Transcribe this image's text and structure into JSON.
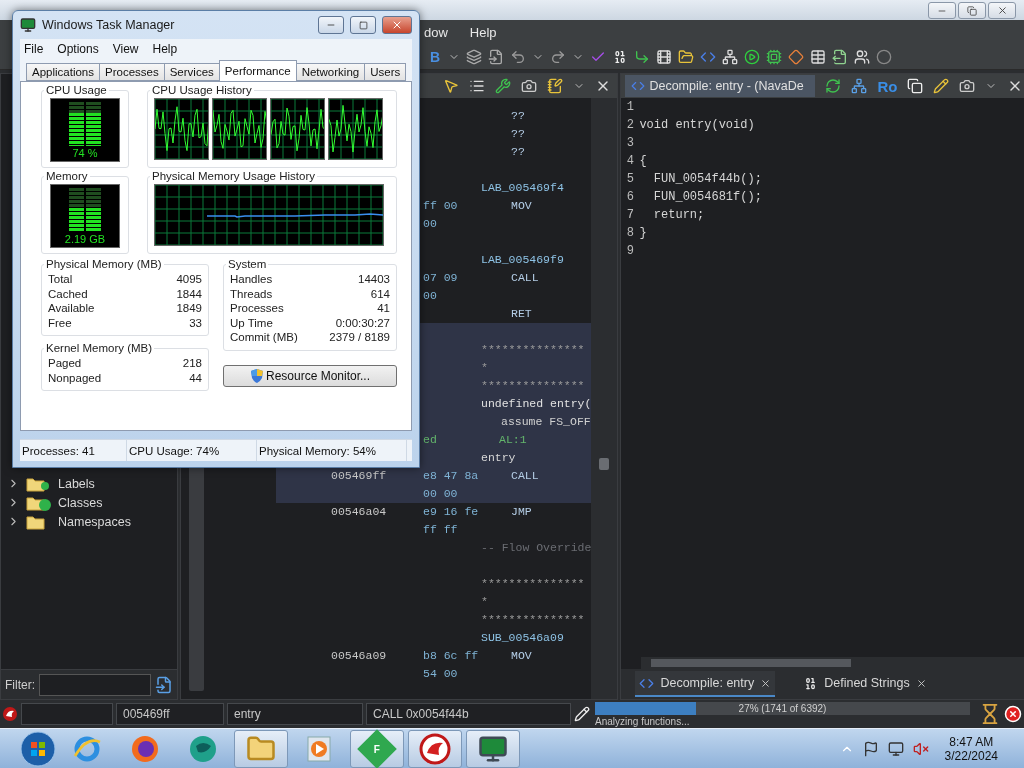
{
  "menu": [
    {
      "label": "dow"
    },
    {
      "label": "Help"
    }
  ],
  "toolbar": {
    "label": "B"
  },
  "tree": [
    {
      "label": "Labels",
      "kind": "labels",
      "expanded": false
    },
    {
      "label": "Classes",
      "kind": "classes",
      "expanded": false
    },
    {
      "label": "Namespaces",
      "kind": "namespaces",
      "expanded": false
    }
  ],
  "filter": {
    "label": "Filter:"
  },
  "listing": {
    "rows": [
      {
        "text": "??",
        "kind": "instruction",
        "selected": false
      },
      {
        "text": "??",
        "kind": "instruction",
        "selected": false
      },
      {
        "text": "??",
        "kind": "instruction",
        "selected": false
      },
      {
        "kind": "blank",
        "selected": false
      },
      {
        "text": "LAB_005469f4",
        "kind": "label",
        "selected": false
      },
      {
        "bytes": "ff 00",
        "text": "MOV",
        "kind": "instruction",
        "selected": false
      },
      {
        "bytes": "00",
        "kind": "continuation",
        "selected": false
      },
      {
        "kind": "blank",
        "selected": false
      },
      {
        "text": "LAB_005469f9",
        "kind": "label",
        "selected": false
      },
      {
        "bytes": "07 09",
        "text": "CALL",
        "kind": "instruction",
        "selected": false
      },
      {
        "bytes": "00",
        "kind": "continuation",
        "selected": false
      },
      {
        "text": "RET",
        "kind": "instruction",
        "selected": false
      },
      {
        "kind": "blank",
        "selected": true
      },
      {
        "text": "***************\n*\n***************",
        "kind": "comment",
        "selected": true
      },
      {
        "text": "undefined entry(",
        "kind": "signature",
        "selected": true
      },
      {
        "text": "assume FS_OFF",
        "kind": "detail",
        "selected": true
      },
      {
        "bytes": "ed",
        "text": "AL:1",
        "kind": "register",
        "selected": true
      },
      {
        "text": "entry",
        "kind": "symbol",
        "selected": true
      },
      {
        "address": "005469ff",
        "bytes": "e8 47 8a",
        "text": "CALL",
        "kind": "instruction",
        "selected": true
      },
      {
        "bytes": "00 00",
        "kind": "continuation",
        "selected": true
      },
      {
        "address": "00546a04",
        "bytes": "e9 16 fe",
        "text": "JMP",
        "kind": "instruction",
        "selected": false
      },
      {
        "bytes": "ff ff",
        "kind": "continuation",
        "selected": false
      },
      {
        "text": "-- Flow Override",
        "kind": "flow",
        "selected": false
      },
      {
        "kind": "blank",
        "selected": false
      },
      {
        "text": "***************\n*\n***************",
        "kind": "comment",
        "selected": false
      },
      {
        "text": "SUB_00546a09",
        "kind": "label",
        "selected": false
      },
      {
        "address": "00546a09",
        "bytes": "b8 6c ff",
        "text": "MOV",
        "kind": "instruction",
        "selected": false
      },
      {
        "bytes": "54 00",
        "kind": "continuation",
        "selected": false
      }
    ]
  },
  "decompiler": {
    "title": "Decompile: entry - (NavaDe",
    "button_label": "Ro",
    "lines": [
      {
        "number": "1"
      },
      {
        "number": "2",
        "code": "void entry(void)"
      },
      {
        "number": "3"
      },
      {
        "number": "4",
        "code": "{"
      },
      {
        "number": "5",
        "code": "  FUN_0054f44b();"
      },
      {
        "number": "6",
        "code": "  FUN_0054681f();"
      },
      {
        "number": "7",
        "code": "  return;"
      },
      {
        "number": "8",
        "code": "}"
      },
      {
        "number": "9"
      }
    ]
  },
  "bottom_tabs": [
    {
      "label": "Decompile: entry",
      "kind": "decompile",
      "selected": true
    },
    {
      "label": "Defined Strings",
      "kind": "strings",
      "selected": false
    }
  ],
  "status_bar": {
    "fields": [
      "005469ff",
      "entry",
      "CALL 0x0054f44b"
    ]
  },
  "progress": {
    "level": 0.27,
    "reading": "27% (1741 of 6392)",
    "message": "Analyzing functions..."
  },
  "task_manager": {
    "title": "Windows Task Manager",
    "menu": [
      "File",
      "Options",
      "View",
      "Help"
    ],
    "tabs": [
      {
        "label": "Applications",
        "selected": false
      },
      {
        "label": "Processes",
        "selected": false
      },
      {
        "label": "Services",
        "selected": false
      },
      {
        "label": "Performance",
        "selected": true
      },
      {
        "label": "Networking",
        "selected": false
      },
      {
        "label": "Users",
        "selected": false
      }
    ],
    "cpu": {
      "title": "CPU Usage",
      "reading": "74 %",
      "level": 0.74
    },
    "cpu_history": {
      "title": "CPU Usage History"
    },
    "memory": {
      "title": "Memory",
      "reading": "2.19 GB",
      "level": 0.54
    },
    "memory_history": {
      "title": "Physical Memory Usage History"
    },
    "physical_memory": {
      "title": "Physical Memory (MB)",
      "rows": [
        {
          "label": "Total",
          "value": "4095"
        },
        {
          "label": "Cached",
          "value": "1844"
        },
        {
          "label": "Available",
          "value": "1849"
        },
        {
          "label": "Free",
          "value": "33"
        }
      ]
    },
    "kernel_memory": {
      "title": "Kernel Memory (MB)",
      "rows": [
        {
          "label": "Paged",
          "value": "218"
        },
        {
          "label": "Nonpaged",
          "value": "44"
        }
      ]
    },
    "system": {
      "title": "System",
      "rows": [
        {
          "label": "Handles",
          "value": "14403"
        },
        {
          "label": "Threads",
          "value": "614"
        },
        {
          "label": "Processes",
          "value": "41"
        },
        {
          "label": "Up Time",
          "value": "0:00:30:27"
        },
        {
          "label": "Commit (MB)",
          "value": "2379 / 8189"
        }
      ]
    },
    "resource_button": "Resource Monitor...",
    "status": [
      "Processes: 41",
      "CPU Usage: 74%",
      "Physical Memory: 54%"
    ]
  },
  "taskbar": {
    "items": [
      {
        "kind": "browser-e",
        "running": false
      },
      {
        "kind": "browser-fox",
        "running": false
      },
      {
        "kind": "globe",
        "running": false
      },
      {
        "kind": "folder",
        "running": true
      },
      {
        "kind": "media",
        "running": false
      },
      {
        "kind": "letter",
        "label": "F",
        "running": true
      },
      {
        "kind": "dragon",
        "running": true
      },
      {
        "kind": "monitor",
        "running": true
      }
    ],
    "clock": {
      "time": "8:47 AM",
      "date": "3/22/2024"
    }
  }
}
